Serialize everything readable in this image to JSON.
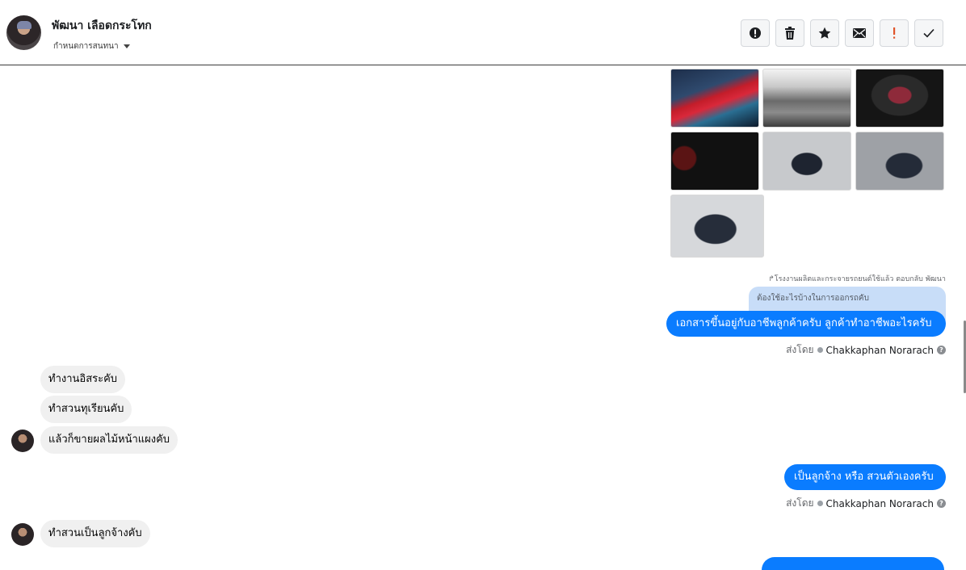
{
  "header": {
    "contact_name": "พัฒนา เลือดกระโทก",
    "conversation_settings": "กำหนดการสนทนา",
    "actions": [
      {
        "name": "report-icon"
      },
      {
        "name": "trash-icon"
      },
      {
        "name": "star-icon"
      },
      {
        "name": "mail-icon"
      },
      {
        "name": "important-icon"
      },
      {
        "name": "check-icon"
      }
    ]
  },
  "reply": {
    "meta": "โรงงานผลิตและกระจายรถยนต์ใช้แล้ว ตอบกลับ พัฒนา",
    "quoted": "ต้องใช้อะไรบ้างในการออกรถคับ"
  },
  "messages": {
    "out1": "เอกสารขึ้นอยู่กับอาชีพลูกค้าครับ ลูกค้าทำอาชีพอะไรครับ",
    "sent_by_label": "ส่งโดย",
    "agent_name": "Chakkaphan Norarach",
    "in1": "ทำงานอิสระคับ",
    "in2": "ทำสวนทุเรียนคับ",
    "in3": "แล้วก็ขายผลไม้หน้าแผงคับ",
    "out2": "เป็นลูกจ้าง หรือ สวนตัวเองครับ",
    "in4": "ทำสวนเป็นลูกจ้างคับ"
  },
  "colors": {
    "outgoing_bubble": "#0a7cff",
    "incoming_bubble": "#f0f0f0",
    "quoted_bubble": "#c8ddf8"
  }
}
